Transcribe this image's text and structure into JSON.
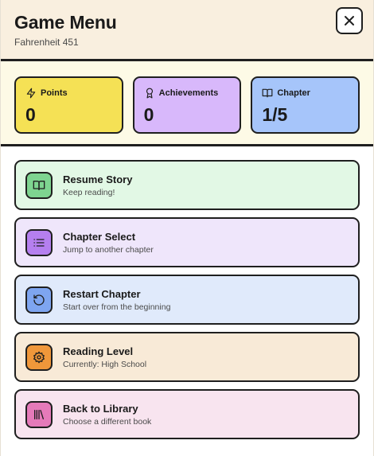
{
  "header": {
    "title": "Game Menu",
    "subtitle": "Fahrenheit 451",
    "close_icon": "close-icon"
  },
  "stats": [
    {
      "label": "Points",
      "value": "0",
      "icon": "lightning-icon",
      "color": "#f5e155"
    },
    {
      "label": "Achievements",
      "value": "0",
      "icon": "award-icon",
      "color": "#d8b8fb"
    },
    {
      "label": "Chapter",
      "value": "1/5",
      "icon": "book-open-icon",
      "color": "#a6c5fa"
    }
  ],
  "menu": [
    {
      "title": "Resume Story",
      "description": "Keep reading!",
      "icon": "book-open-icon",
      "bg": "#e2f8e5",
      "icon_bg": "#7ed490"
    },
    {
      "title": "Chapter Select",
      "description": "Jump to another chapter",
      "icon": "list-icon",
      "bg": "#efe6fb",
      "icon_bg": "#b57fef"
    },
    {
      "title": "Restart Chapter",
      "description": "Start over from the beginning",
      "icon": "restart-icon",
      "bg": "#e0eafb",
      "icon_bg": "#7ea5f0"
    },
    {
      "title": "Reading Level",
      "description": "Currently: High School",
      "icon": "gear-icon",
      "bg": "#f8ead7",
      "icon_bg": "#f0973a"
    },
    {
      "title": "Back to Library",
      "description": "Choose a different book",
      "icon": "library-icon",
      "bg": "#f8e4ef",
      "icon_bg": "#e57ab9"
    }
  ]
}
